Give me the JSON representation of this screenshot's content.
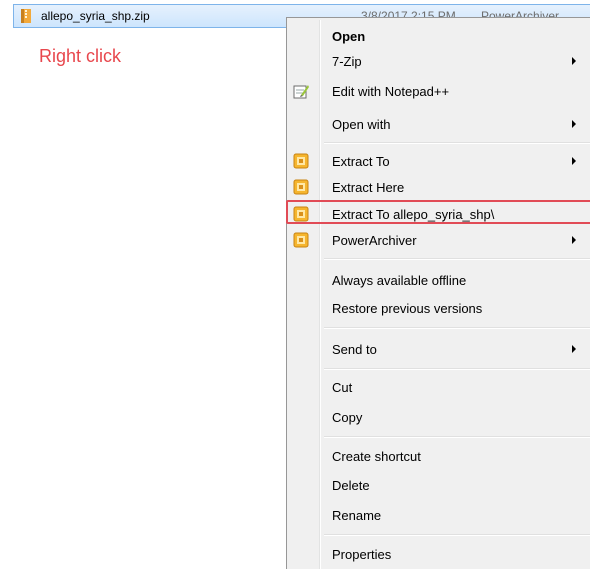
{
  "file": {
    "name": "allepo_syria_shp.zip",
    "date": "3/8/2017 2:15 PM",
    "type": "PowerArchiver",
    "icon": "zip-file-icon"
  },
  "annotation": "Right click",
  "colors": {
    "annotation": "#e8474d",
    "highlight_border": "#e14b56",
    "menu_background": "#f0f0f0",
    "selection_row": "#cde5fd"
  },
  "menu": {
    "open": "Open",
    "seven_zip": "7-Zip",
    "edit_notepad": "Edit with Notepad++",
    "open_with": "Open with",
    "extract_to": "Extract To",
    "extract_here": "Extract Here",
    "extract_to_folder": "Extract To allepo_syria_shp\\",
    "powerarchiver": "PowerArchiver",
    "always_offline": "Always available offline",
    "restore_versions": "Restore previous versions",
    "send_to": "Send to",
    "cut": "Cut",
    "copy": "Copy",
    "create_shortcut": "Create shortcut",
    "delete": "Delete",
    "rename": "Rename",
    "properties": "Properties"
  }
}
